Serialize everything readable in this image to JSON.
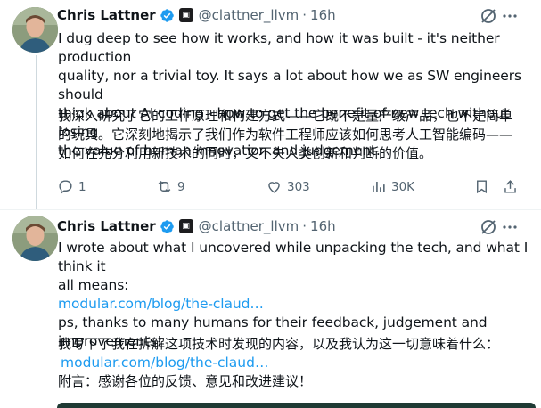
{
  "colors": {
    "text_primary": "#0f1419",
    "text_secondary": "#536471",
    "link": "#1d9bf0",
    "verified_badge": "#1d9bf0",
    "thread_line": "#cfd9de"
  },
  "tweets": [
    {
      "author": "Chris Lattner",
      "handle": "@clattner_llvm",
      "separator": "·",
      "time": "16h",
      "text_en_lines": [
        "I dug deep to see how it works, and how it was built - it's neither production",
        "quality, nor a trivial toy. It says a lot about how we as SW engineers should",
        "think about AI coding - how to get the benefit of new tech without losing",
        "the value of human innovation and judgement."
      ],
      "text_zh_lines": [
        "我深入研究了它的工作原理和构建方式——它既不是量产级产品，也不是简单",
        "的玩具。它深刻地揭示了我们作为软件工程师应该如何思考人工智能编码——",
        "如何在充分利用新技术的同时，又不失人类创新和判断的价值。"
      ],
      "replies": "1",
      "retweets": "9",
      "likes": "303",
      "views": "30K",
      "icons": [
        "verified-badge-icon",
        "affiliate-badge-icon",
        "grok-icon",
        "more-icon",
        "reply-icon",
        "retweet-icon",
        "like-icon",
        "views-icon",
        "bookmark-icon",
        "share-icon"
      ]
    },
    {
      "author": "Chris Lattner",
      "handle": "@clattner_llvm",
      "separator": "·",
      "time": "16h",
      "text_en_lines": [
        "I wrote about what I uncovered while unpacking the tech, and what I think it",
        "all means:"
      ],
      "link_1": "modular.com/blog/the-claud…",
      "text_en_after_lines": [
        "ps, thanks to many humans for their feedback, judgement and",
        "improvements!"
      ],
      "text_zh_line": "我写下了我在拆解这项技术时发现的内容，以及我认为这一切意味着什么：",
      "link_2": "modular.com/blog/the-claud…",
      "text_zh_after": "附言：感谢各位的反馈、意见和改进建议！"
    }
  ]
}
